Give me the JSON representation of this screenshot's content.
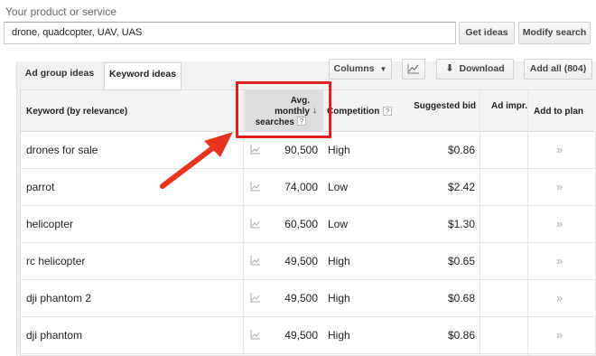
{
  "search": {
    "label": "Your product or service",
    "value": "drone, quadcopter, UAV, UAS",
    "get_ideas": "Get ideas",
    "modify_search": "Modify search"
  },
  "tabs": [
    {
      "label": "Ad group ideas",
      "active": false
    },
    {
      "label": "Keyword ideas",
      "active": true
    }
  ],
  "toolbar": {
    "columns": "Columns",
    "download": "Download",
    "add_all": "Add all (804)"
  },
  "table": {
    "headers": {
      "keyword": "Keyword (by relevance)",
      "avg_line1": "Avg.",
      "avg_line2": "monthly",
      "avg_line3": "searches",
      "competition": "Competition",
      "bid_line1": "Suggested bid",
      "impr": "Ad impr.",
      "plan": "Add to plan"
    },
    "rows": [
      {
        "keyword": "drones for sale",
        "searches": "90,500",
        "competition": "High",
        "bid": "$0.86"
      },
      {
        "keyword": "parrot",
        "searches": "74,000",
        "competition": "Low",
        "bid": "$2.42"
      },
      {
        "keyword": "helicopter",
        "searches": "60,500",
        "competition": "Low",
        "bid": "$1.30"
      },
      {
        "keyword": "rc helicopter",
        "searches": "49,500",
        "competition": "High",
        "bid": "$0.65"
      },
      {
        "keyword": "dji phantom 2",
        "searches": "49,500",
        "competition": "High",
        "bid": "$0.68"
      },
      {
        "keyword": "dji phantom",
        "searches": "49,500",
        "competition": "High",
        "bid": "$0.86"
      }
    ]
  },
  "colors": {
    "highlight": "#e02020",
    "arrow": "#e8341f",
    "header_bg": "#f3f3f3",
    "sorted_header_bg": "#dddddd"
  }
}
